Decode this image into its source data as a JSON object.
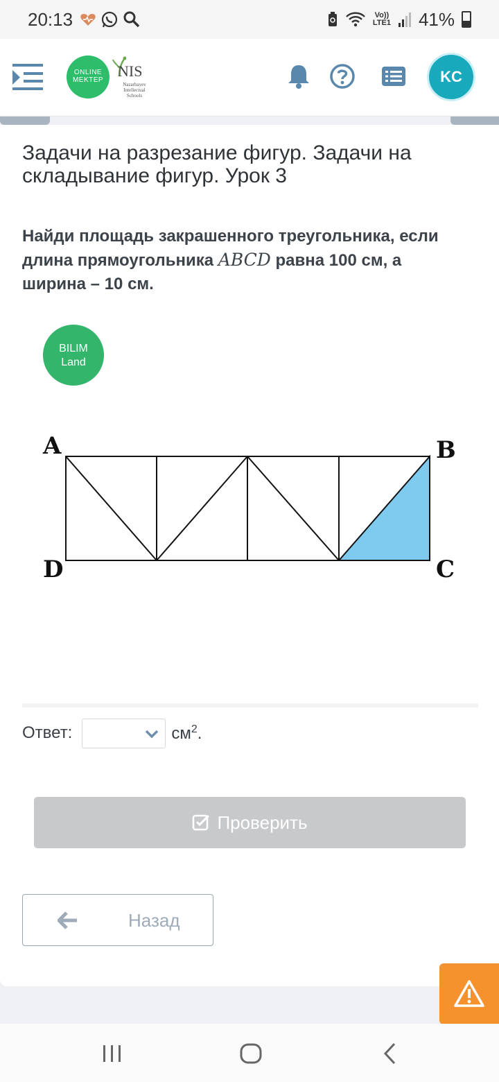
{
  "status_bar": {
    "time": "20:13",
    "network_top": "Vo))",
    "network_bottom": "LTE1",
    "battery": "41%"
  },
  "header": {
    "logo_online_line1": "ONLINE",
    "logo_online_line2": "MEKTEP",
    "logo_nis_main": "NIS",
    "logo_nis_line1": "Nazarbayev",
    "logo_nis_line2": "Intellectual",
    "logo_nis_line3": "Schools",
    "avatar_initials": "KC"
  },
  "lesson": {
    "title": "Задачи на разрезание фигур. Задачи на складывание фигур. Урок 3"
  },
  "question": {
    "text_before": "Найди площадь закрашенного треугольника, если длина прямоугольника ",
    "math": "ABCD",
    "text_after": " равна 100 см, а ширина – 10 см."
  },
  "bilim_logo": {
    "line1": "BILIM",
    "line2": "Land"
  },
  "figure": {
    "vertex_a": "A",
    "vertex_b": "B",
    "vertex_c": "C",
    "vertex_d": "D",
    "fill_color": "#7ecbef"
  },
  "answer": {
    "label": "Ответ:",
    "selected_value": "",
    "unit": "см",
    "unit_power": "2",
    "unit_suffix": "."
  },
  "buttons": {
    "check_label": "Проверить",
    "back_label": "Назад"
  },
  "colors": {
    "accent_green": "#2ebd6b",
    "avatar_teal": "#18a9bc",
    "report_orange": "#f5922e",
    "button_disabled": "#c8c9cb"
  }
}
